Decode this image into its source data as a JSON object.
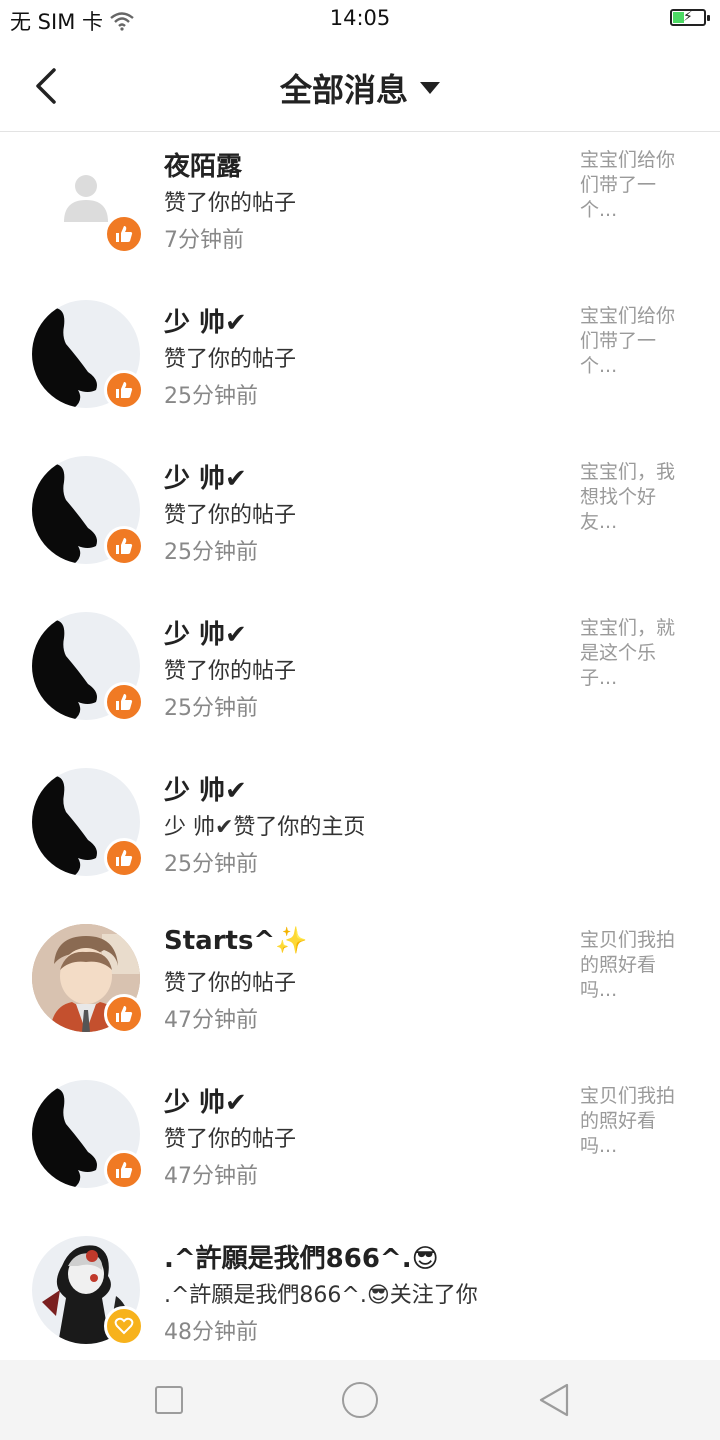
{
  "status_bar": {
    "carrier": "无 SIM 卡",
    "time": "14:05"
  },
  "header": {
    "title": "全部消息"
  },
  "messages": [
    {
      "name": "夜陌露",
      "action": "赞了你的帖子",
      "time": "7分钟前",
      "preview": "宝宝们给你们带了一个...",
      "avatar": "default-avatar",
      "badge": "thumbs-up-icon"
    },
    {
      "name": "少 帅✔",
      "action": "赞了你的帖子",
      "time": "25分钟前",
      "preview": "宝宝们给你们带了一个...",
      "avatar": "silhouette-avatar",
      "badge": "thumbs-up-icon"
    },
    {
      "name": "少 帅✔",
      "action": "赞了你的帖子",
      "time": "25分钟前",
      "preview": "宝宝们，我想找个好友...",
      "avatar": "silhouette-avatar",
      "badge": "thumbs-up-icon"
    },
    {
      "name": "少 帅✔",
      "action": "赞了你的帖子",
      "time": "25分钟前",
      "preview": "宝宝们，就是这个乐子...",
      "avatar": "silhouette-avatar",
      "badge": "thumbs-up-icon"
    },
    {
      "name": "少 帅✔",
      "action": "少 帅✔赞了你的主页",
      "time": "25分钟前",
      "preview": "",
      "avatar": "silhouette-avatar",
      "badge": "thumbs-up-icon"
    },
    {
      "name": "Starts^✨",
      "action": "赞了你的帖子",
      "time": "47分钟前",
      "preview": "宝贝们我拍的照好看吗...",
      "avatar": "anime-avatar",
      "badge": "thumbs-up-icon"
    },
    {
      "name": "少 帅✔",
      "action": "赞了你的帖子",
      "time": "47分钟前",
      "preview": "宝贝们我拍的照好看吗...",
      "avatar": "silhouette-avatar",
      "badge": "thumbs-up-icon"
    },
    {
      "name": ".^許願是我們866^.😎",
      "action": ".^許願是我們866^.😎关注了你",
      "time": "48分钟前",
      "preview": "",
      "avatar": "character-avatar",
      "badge": "heart-icon"
    }
  ],
  "colors": {
    "like_badge": "#f07a24",
    "follow_badge": "#f7b21c",
    "time_text": "#888888",
    "preview_text": "#9a9a9a"
  }
}
